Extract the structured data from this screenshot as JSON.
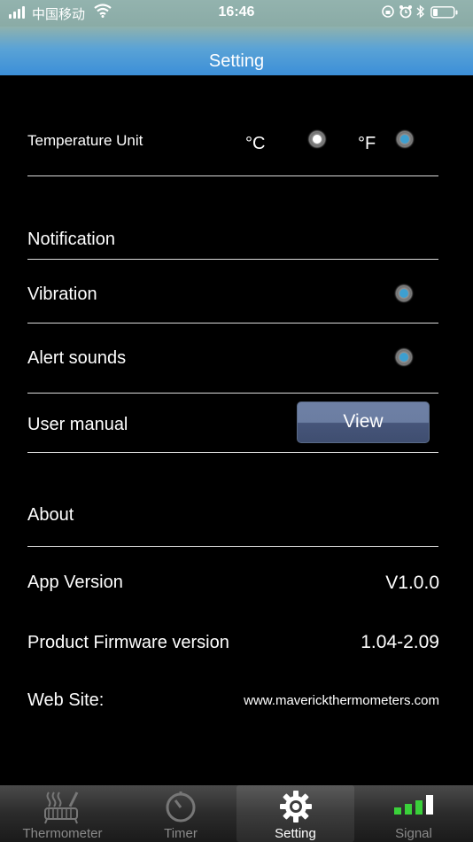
{
  "status_bar": {
    "carrier": "中国移动",
    "time": "16:46"
  },
  "title": "Setting",
  "temperature": {
    "label": "Temperature Unit",
    "celsius": "°C",
    "fahrenheit": "°F",
    "selected": "celsius"
  },
  "notification": {
    "header": "Notification",
    "vibration": "Vibration",
    "alert_sounds": "Alert sounds"
  },
  "user_manual": {
    "label": "User manual",
    "button": "View"
  },
  "about": {
    "header": "About",
    "app_version_label": "App Version",
    "app_version": "V1.0.0",
    "firmware_label": "Product Firmware version",
    "firmware": "1.04-2.09",
    "website_label": "Web Site:",
    "website": "www.maverickthermometers.com"
  },
  "tabs": [
    {
      "label": "Thermometer",
      "icon": "thermometer-grill-icon"
    },
    {
      "label": "Timer",
      "icon": "timer-icon"
    },
    {
      "label": "Setting",
      "icon": "gear-icon"
    },
    {
      "label": "Signal",
      "icon": "signal-bars-icon"
    }
  ],
  "colors": {
    "accent": "#3c8fd8",
    "radio_off": "#3d9fd0",
    "signal_green": "#3ad13a"
  }
}
